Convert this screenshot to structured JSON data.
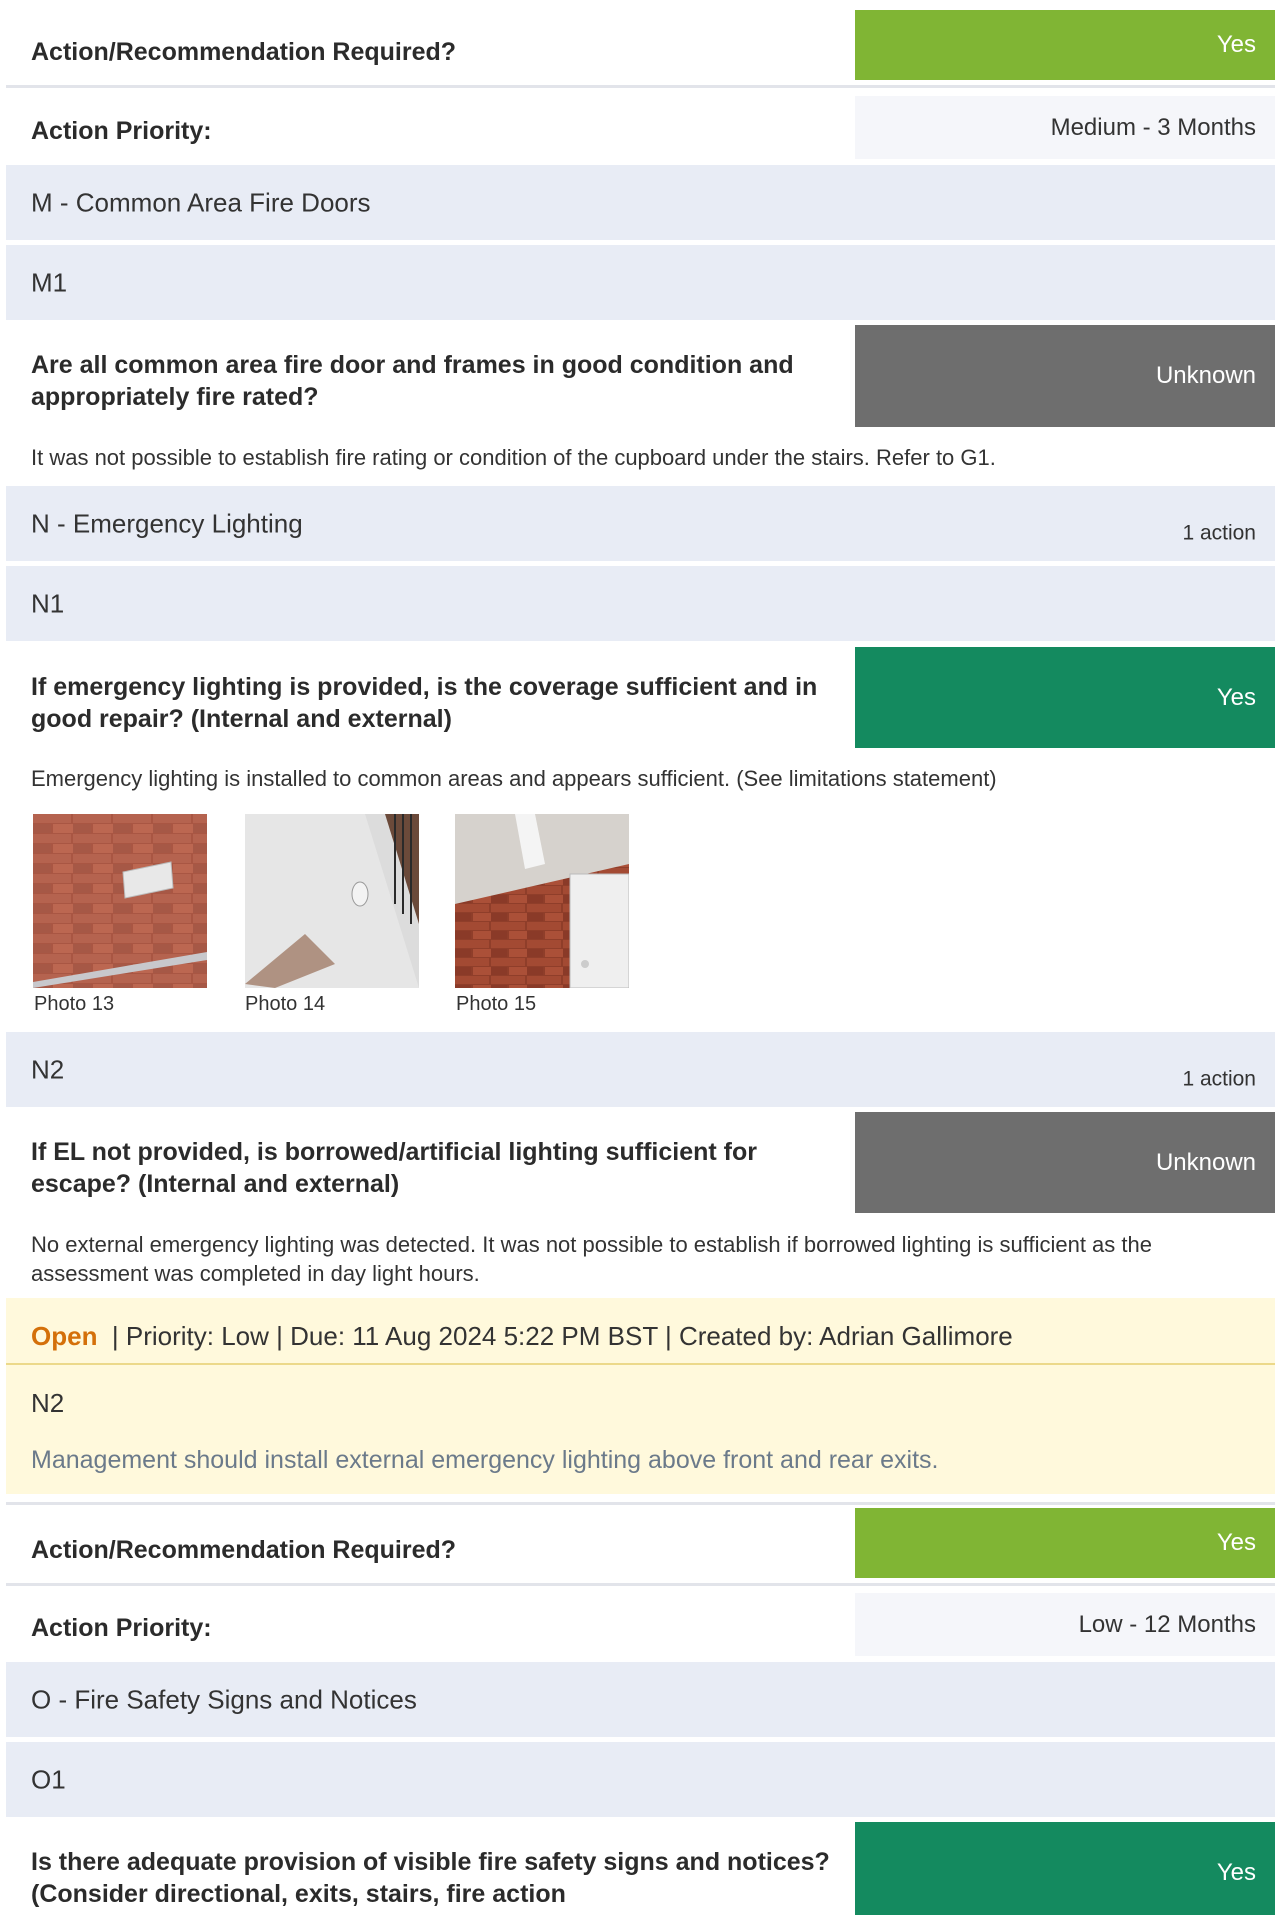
{
  "block1": {
    "question": "Action/Recommendation Required?",
    "answer": "Yes",
    "answer_color": "#80b534"
  },
  "block2": {
    "question": "Action Priority:",
    "answer": "Medium - 3 Months"
  },
  "section_m": {
    "title": "M  -  Common Area Fire Doors"
  },
  "sub_m1": {
    "title": "M1"
  },
  "q_m1": {
    "question": "Are all common area fire door and frames in good condition and appropriately fire rated?",
    "answer": "Unknown",
    "note": "It was not possible to establish fire rating or condition of the cupboard under the stairs. Refer to G1."
  },
  "section_n": {
    "title": "N  -  Emergency Lighting",
    "actions": "1 action"
  },
  "sub_n1": {
    "title": "N1"
  },
  "q_n1": {
    "question": "If emergency lighting is provided, is the coverage sufficient and in good repair? (Internal and external)",
    "answer": "Yes",
    "answer_color": "#148a5f",
    "note": "Emergency lighting is installed to common areas and appears sufficient. (See limitations statement)",
    "photos": [
      "Photo 13",
      "Photo 14",
      "Photo 15"
    ]
  },
  "sub_n2": {
    "title": "N2",
    "actions": "1 action"
  },
  "q_n2": {
    "question": "If EL not provided, is borrowed/artificial lighting sufficient for escape? (Internal and external)",
    "answer": "Unknown",
    "note": "No external emergency lighting was detected. It was not possible to establish if borrowed lighting is sufficient as the assessment was completed in day light hours."
  },
  "action": {
    "status": "Open",
    "status_color": "#d4700a",
    "meta": "| Priority: Low  |  Due: 11 Aug 2024 5:22 PM BST  |  Created by: Adrian Gallimore",
    "ref": "N2",
    "text": "Management should install external emergency lighting above front and rear exits."
  },
  "block3": {
    "question": "Action/Recommendation Required?",
    "answer": "Yes"
  },
  "block4": {
    "question": "Action Priority:",
    "answer": "Low - 12 Months"
  },
  "section_o": {
    "title": "O  -  Fire Safety Signs and Notices"
  },
  "sub_o1": {
    "title": "O1"
  },
  "q_o1": {
    "question": "Is there adequate provision of  visible fire safety signs and notices? (Consider directional, exits, stairs, fire action",
    "answer": "Yes"
  }
}
